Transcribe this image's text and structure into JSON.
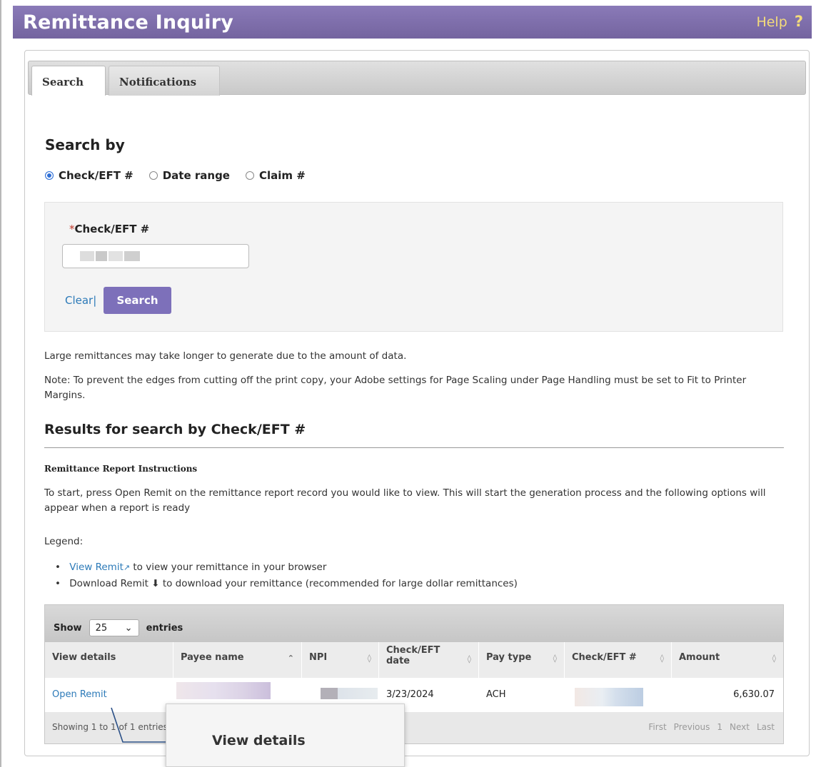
{
  "header": {
    "title": "Remittance Inquiry",
    "help_label": "Help",
    "help_icon": "?"
  },
  "tabs": [
    {
      "label": "Search",
      "active": true
    },
    {
      "label": "Notifications",
      "active": false
    }
  ],
  "search": {
    "heading": "Search by",
    "options": [
      {
        "label": "Check/EFT #",
        "checked": true
      },
      {
        "label": "Date range",
        "checked": false
      },
      {
        "label": "Claim #",
        "checked": false
      }
    ],
    "field_required_mark": "*",
    "field_label": "Check/EFT #",
    "clear_label": "Clear|",
    "search_button": "Search"
  },
  "notes": {
    "large": "Large remittances may take longer to generate due to the amount of data.",
    "print_note": "Note: To prevent the edges from cutting off the print copy, your Adobe settings for Page Scaling under Page Handling must be set to Fit to Printer Margins."
  },
  "results": {
    "heading": "Results for search by Check/EFT #",
    "instructions_heading": "Remittance Report Instructions",
    "instructions_text": "To start, press Open Remit on the remittance report record you would like to view. This will start the generation process and the following options will appear when a report is ready",
    "legend_label": "Legend:",
    "legend_items": [
      {
        "link": "View Remit",
        "icon": "↗",
        "text": " to view your remittance in your browser"
      },
      {
        "link": "Download Remit",
        "icon": "⬇",
        "text": " to download your remittance (recommended for large dollar remittances)"
      }
    ]
  },
  "table": {
    "show_label": "Show",
    "entries_value": "25",
    "entries_label": "entries",
    "columns": [
      "View details",
      "Payee name",
      "NPI",
      "Check/EFT date",
      "Pay type",
      "Check/EFT #",
      "Amount"
    ],
    "rows": [
      {
        "view": "Open Remit",
        "payee": "",
        "npi": "",
        "date": "3/23/2024",
        "pay_type": "ACH",
        "check": "",
        "amount": "6,630.07"
      }
    ],
    "info": "Showing 1 to 1 of 1 entries",
    "pager": [
      "First",
      "Previous",
      "1",
      "Next",
      "Last"
    ]
  },
  "callout": {
    "label": "View details"
  }
}
